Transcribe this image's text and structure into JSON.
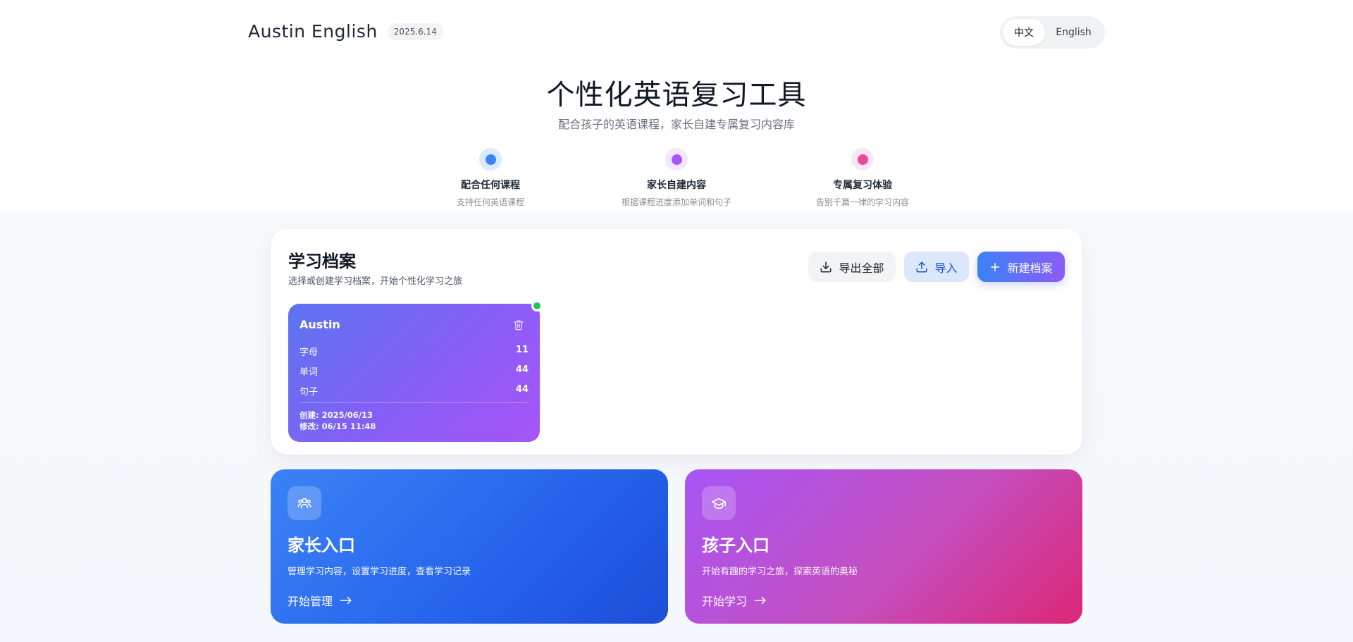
{
  "header": {
    "brand_name": "Austin English",
    "version": "2025.6.14",
    "lang_options": [
      "中文",
      "English"
    ],
    "active_lang": "中文"
  },
  "hero": {
    "title": "个性化英语复习工具",
    "subtitle": "配合孩子的英语课程，家长自建专属复习内容库",
    "features": [
      {
        "title": "配合任何课程",
        "desc": "支持任何英语课程",
        "color": "#3b82f6"
      },
      {
        "title": "家长自建内容",
        "desc": "根据课程进度添加单词和句子",
        "color": "#a855f7"
      },
      {
        "title": "专属复习体验",
        "desc": "告别千篇一律的学习内容",
        "color": "#ec4899"
      }
    ]
  },
  "profiles_panel": {
    "title": "学习档案",
    "subtitle": "选择或创建学习档案，开始个性化学习之旅",
    "export_label": "导出全部",
    "import_label": "导入",
    "new_label": "新建档案",
    "profiles": [
      {
        "name": "Austin",
        "stats": [
          {
            "label": "字母",
            "value": "11"
          },
          {
            "label": "单词",
            "value": "44"
          },
          {
            "label": "句子",
            "value": "44"
          }
        ],
        "created": "创建: 2025/06/13",
        "modified": "修改: 06/15 11:48",
        "active": true
      }
    ]
  },
  "entries": {
    "parent": {
      "title": "家长入口",
      "desc": "管理学习内容，设置学习进度，查看学习记录",
      "cta": "开始管理"
    },
    "kid": {
      "title": "孩子入口",
      "desc": "开始有趣的学习之旅，探索英语的奥秘",
      "cta": "开始学习"
    }
  },
  "icons": {
    "download": "download-icon",
    "upload": "upload-icon",
    "plus": "plus-icon",
    "trash": "trash-icon",
    "users": "users-icon",
    "graduation": "graduation-cap-icon",
    "arrow": "arrow-right-icon"
  }
}
